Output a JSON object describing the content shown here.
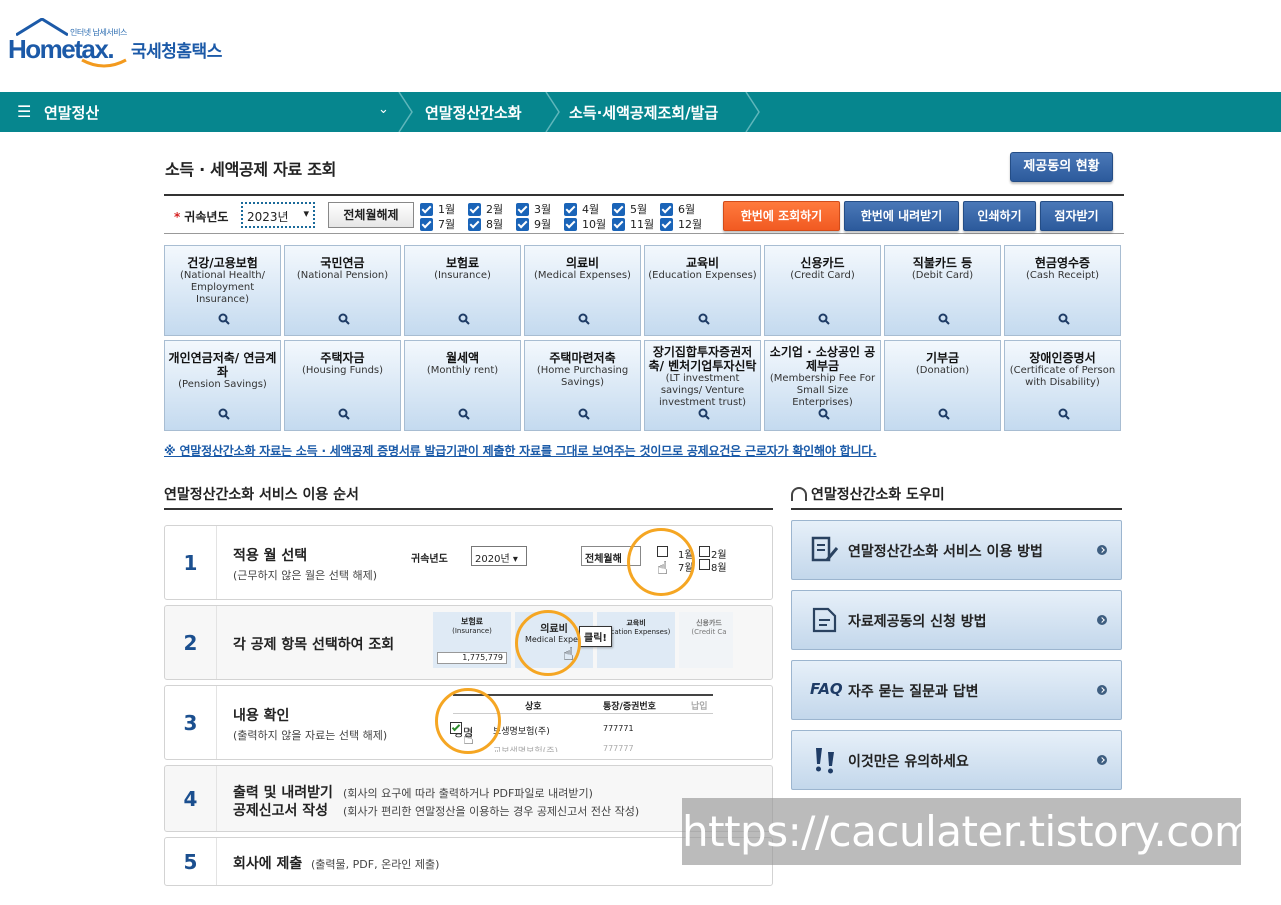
{
  "header": {
    "logo_sub": "인터넷 납세서비스",
    "logo_text": "Hometax.",
    "logo_kr": "국세청홈택스"
  },
  "nav": {
    "menu": "연말정산",
    "crumb1": "연말정산간소화",
    "crumb2": "소득·세액공제조회/발급"
  },
  "page": {
    "title": "소득 · 세액공제 자료 조회",
    "status_btn": "제공동의 현황"
  },
  "filter": {
    "year_label": "귀속년도",
    "year_value": "2023년",
    "clear_btn": "전체월해제",
    "months": [
      "1월",
      "7월",
      "2월",
      "8월",
      "3월",
      "9월",
      "4월",
      "10월",
      "5월",
      "11월",
      "6월",
      "12월"
    ],
    "btn_query": "한번에 조회하기",
    "btn_download": "한번에 내려받기",
    "btn_print": "인쇄하기",
    "btn_braille": "점자받기"
  },
  "tiles_row1": [
    {
      "k": "건강/고용보험",
      "e": "(National Health/ Employment Insurance)"
    },
    {
      "k": "국민연금",
      "e": "(National Pension)"
    },
    {
      "k": "보험료",
      "e": "(Insurance)"
    },
    {
      "k": "의료비",
      "e": "(Medical Expenses)"
    },
    {
      "k": "교육비",
      "e": "(Education Expenses)"
    },
    {
      "k": "신용카드",
      "e": "(Credit Card)"
    },
    {
      "k": "직불카드 등",
      "e": "(Debit Card)"
    },
    {
      "k": "현금영수증",
      "e": "(Cash Receipt)"
    }
  ],
  "tiles_row2": [
    {
      "k": "개인연금저축/ 연금계좌",
      "e": "(Pension Savings)"
    },
    {
      "k": "주택자금",
      "e": "(Housing Funds)"
    },
    {
      "k": "월세액",
      "e": "(Monthly rent)"
    },
    {
      "k": "주택마련저축",
      "e": "(Home Purchasing Savings)"
    },
    {
      "k": "장기집합투자증권저축/ 벤처기업투자신탁",
      "e": "(LT investment savings/ Venture investment trust)"
    },
    {
      "k": "소기업 · 소상공인 공제부금",
      "e": "(Membership Fee For Small Size Enterprises)"
    },
    {
      "k": "기부금",
      "e": "(Donation)"
    },
    {
      "k": "장애인증명서",
      "e": "(Certificate of Person with Disability)"
    }
  ],
  "notice": "※ 연말정산간소화 자료는 소득 · 세액공제 증명서류 발급기관이 제출한 자료를 그대로 보여주는 것이므로 공제요건은 근로자가 확인해야 합니다.",
  "steps_title": "연말정산간소화 서비스 이용 순서",
  "steps": [
    {
      "num": "1",
      "title": "적용 월 선택",
      "desc": "(근무하지 않은 월은 선택 해제)"
    },
    {
      "num": "2",
      "title": "각 공제 항목 선택하여 조회",
      "desc": ""
    },
    {
      "num": "3",
      "title": "내용 확인",
      "desc": "(출력하지 않을 자료는 선택 해제)"
    },
    {
      "num": "4",
      "title": "출력 및 내려받기",
      "desc": "(회사의 요구에 따라 출력하거나 PDF파일로 내려받기)",
      "title2": "공제신고서 작성",
      "desc2": "(회사가 편리한 연말정산을 이용하는 경우 공제신고서 전산 작성)"
    },
    {
      "num": "5",
      "title": "회사에 제출",
      "desc": "(출력물, PDF, 온라인 제출)"
    }
  ],
  "illus": {
    "s1_label": "귀속년도",
    "s1_year": "2020년",
    "s1_btn": "전체월해",
    "s1_m1": "1월",
    "s1_m7": "7월",
    "s1_m2": "2월",
    "s1_m8": "8월",
    "s2_t1": "보험료",
    "s2_e1": "(Insurance)",
    "s2_val": "1,775,779",
    "s2_t2": "의료비",
    "s2_e2": "Medical Expen",
    "s2_click": "클릭!",
    "s2_t3": "교육비",
    "s2_e3": "ducation Expenses)",
    "s2_t4": "신용카드",
    "s2_e4": "(Credit Ca",
    "s3_h1": "상호",
    "s3_h2": "통장/증권번호",
    "s3_h3": "납입",
    "s3_c1": "생명",
    "s3_c2": "보생명보험(주)",
    "s3_c3": "777771",
    "s3_c4": "교보생명보험(주)",
    "s3_c5": "777777"
  },
  "help_title": "연말정산간소화 도우미",
  "help": [
    {
      "label": "연말정산간소화 서비스 이용 방법",
      "icon": "document-pen-icon"
    },
    {
      "label": "자료제공동의 신청 방법",
      "icon": "document-icon"
    },
    {
      "label": "자주 묻는 질문과 답변",
      "icon": "faq-icon",
      "prefix": "FAQ"
    },
    {
      "label": "이것만은 유의하세요",
      "icon": "exclamation-icon"
    }
  ],
  "watermark": "https://caculater.tistory.com",
  "colors": {
    "nav": "#06868e",
    "primary": "#2c5a9c",
    "orange": "#f15a22",
    "link": "#1a5aa8"
  }
}
